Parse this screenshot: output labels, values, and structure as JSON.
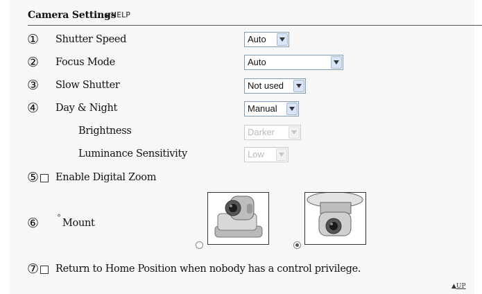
{
  "header": {
    "title": "Camera Settings",
    "help_label": "HELP",
    "help_arrow": "▶"
  },
  "numbers": [
    "①",
    "②",
    "③",
    "④",
    "⑤",
    "⑥",
    "⑦"
  ],
  "shutter_speed": {
    "label": "Shutter Speed",
    "value": "Auto"
  },
  "focus_mode": {
    "label": "Focus Mode",
    "value": "Auto"
  },
  "slow_shutter": {
    "label": "Slow Shutter",
    "value": "Not used"
  },
  "day_night": {
    "label": "Day & Night",
    "value": "Manual"
  },
  "brightness": {
    "label": "Brightness",
    "value": "Darker"
  },
  "luminance": {
    "label": "Luminance Sensitivity",
    "value": "Low"
  },
  "digital_zoom": {
    "label": "Enable Digital Zoom",
    "checked": false
  },
  "mount": {
    "label": "Mount",
    "bullet": "°",
    "selected_option": "ceiling"
  },
  "home_position": {
    "label": "Return to Home Position when nobody has a control privilege.",
    "checked": false
  },
  "footer": {
    "up_label": "UP",
    "up_arrow": "▲"
  }
}
